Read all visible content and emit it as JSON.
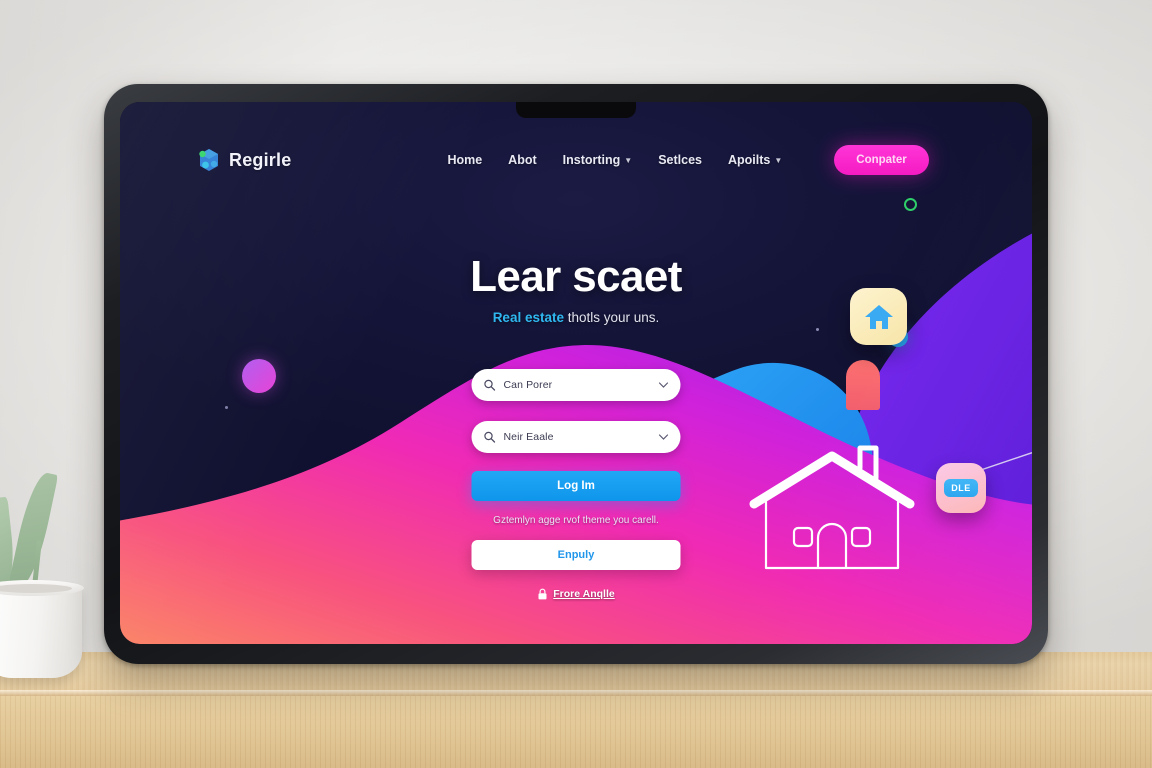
{
  "scene": {
    "description": "tablet-on-desk product mockup",
    "surface": "wooden-table",
    "plant": "potted-green-plant"
  },
  "device": {
    "name": "tablet",
    "bezel_color": "#16181c",
    "screen_bg": "#141435"
  },
  "nav": {
    "brand": "Regirle",
    "links": [
      {
        "label": "Home",
        "has_caret": false
      },
      {
        "label": "Abot",
        "has_caret": false
      },
      {
        "label": "Instorting",
        "has_caret": true
      },
      {
        "label": "Setlces",
        "has_caret": false
      },
      {
        "label": "Apoilts",
        "has_caret": true
      }
    ],
    "cta_label": "Conpater",
    "cta_color": "#f51bc3"
  },
  "hero": {
    "title": "Lear scaet",
    "subtitle_accent": "Real estate",
    "subtitle_rest": "thotls your uns."
  },
  "form": {
    "fields": [
      {
        "value": "Can Porer",
        "icon": "search-icon",
        "caret": "chevron-down-icon"
      },
      {
        "value": "Neir Eaale",
        "icon": "search-icon",
        "caret": "chevron-down-icon"
      }
    ],
    "primary_button": "Log Im",
    "primary_color": "#0e96ec",
    "helper_text": "Gztemlyn agge rvof theme you carell.",
    "secondary_button": "Enpuly",
    "secondary_text_color": "#2196ea",
    "footer_link_text": "Frore Anqlle",
    "footer_icon": "lock-icon"
  },
  "decor": {
    "badge_home_icon": "house-icon",
    "badge_home_bg": "#f7e5a8",
    "badge_dle_label": "DLE",
    "badge_dle_bg": "#fbc9e8",
    "dot_purple": "#c346e0",
    "dot_blue": "#2aa8f5",
    "dot_ring": "#2fcf6a",
    "coral_pill": "#f96a6e",
    "wave_left_colors": [
      "#fb8467",
      "#f43f9c",
      "#d923dd",
      "#8c2ae8"
    ],
    "wave_right_color": "#6a22e8",
    "blob_blue_color": "#1f9bf0"
  }
}
